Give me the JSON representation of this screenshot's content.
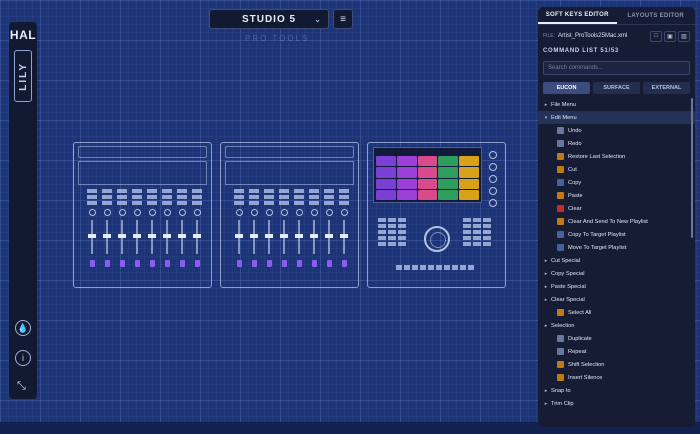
{
  "rail": {
    "logo_text": "HAL",
    "product_text": "LILY",
    "drop_icon": "drop-icon",
    "info_icon": "info-icon",
    "expand_icon": "expand-icon"
  },
  "header": {
    "studio_label": "STUDIO 5",
    "ghost_label": "PRO TOOLS"
  },
  "panel": {
    "tabs": [
      "SOFT KEYS EDITOR",
      "LAYOUTS EDITOR"
    ],
    "file_label": "FILE:",
    "file_name": "Artist_ProTools25Mac.xml",
    "command_list_title": "COMMAND LIST  51/53",
    "search_placeholder": "Search commands...",
    "segments": [
      "EUCON",
      "SURFACE",
      "EXTERNAL"
    ],
    "items": [
      {
        "kind": "folder",
        "open": false,
        "label": "File Menu"
      },
      {
        "kind": "folder",
        "open": true,
        "label": "Edit Menu"
      },
      {
        "kind": "cmd",
        "icon": "undo-icon",
        "color": "#6b7799",
        "label": "Undo"
      },
      {
        "kind": "cmd",
        "icon": "redo-icon",
        "color": "#6b7799",
        "label": "Redo"
      },
      {
        "kind": "cmd",
        "icon": "restore-icon",
        "color": "#c07a12",
        "label": "Restore Last Selection"
      },
      {
        "kind": "cmd",
        "icon": "cut-icon",
        "color": "#c07a12",
        "label": "Cut"
      },
      {
        "kind": "cmd",
        "icon": "copy-icon",
        "color": "#4a5f9c",
        "label": "Copy"
      },
      {
        "kind": "cmd",
        "icon": "paste-icon",
        "color": "#c07a12",
        "label": "Paste"
      },
      {
        "kind": "cmd",
        "icon": "clear-icon",
        "color": "#c42b2b",
        "label": "Clear"
      },
      {
        "kind": "cmd",
        "icon": "clear-send-icon",
        "color": "#c07a12",
        "label": "Clear And Send To New Playlist"
      },
      {
        "kind": "cmd",
        "icon": "copy-target-icon",
        "color": "#4a5f9c",
        "label": "Copy To Target Playlist"
      },
      {
        "kind": "cmd",
        "icon": "move-target-icon",
        "color": "#4a5f9c",
        "label": "Move To Target Playlist"
      },
      {
        "kind": "folder",
        "open": false,
        "label": "Cut Special"
      },
      {
        "kind": "folder",
        "open": false,
        "label": "Copy Special"
      },
      {
        "kind": "folder",
        "open": false,
        "label": "Paste Special"
      },
      {
        "kind": "folder",
        "open": false,
        "label": "Clear Special"
      },
      {
        "kind": "cmd",
        "icon": "select-all-icon",
        "color": "#c07a12",
        "label": "Select All"
      },
      {
        "kind": "folder",
        "open": false,
        "label": "Selection"
      },
      {
        "kind": "cmd",
        "icon": "duplicate-icon",
        "color": "#6b7799",
        "label": "Duplicate"
      },
      {
        "kind": "cmd",
        "icon": "repeat-icon",
        "color": "#6b7799",
        "label": "Repeat"
      },
      {
        "kind": "cmd",
        "icon": "shift-icon",
        "color": "#c07a12",
        "label": "Shift Selection"
      },
      {
        "kind": "cmd",
        "icon": "insert-silence-icon",
        "color": "#c07a12",
        "label": "Insert Silence"
      },
      {
        "kind": "folder",
        "open": false,
        "label": "Snap to"
      },
      {
        "kind": "folder",
        "open": false,
        "label": "Trim Clip"
      }
    ]
  },
  "colors": {
    "background": "#1d3577",
    "panel": "#151c33",
    "accent": "#8a5cf0",
    "touch_keys": [
      "#7c3fd6",
      "#9b3fd6",
      "#d84a8a",
      "#2f9d5b",
      "#d7a21a",
      "#2a7fd4"
    ]
  }
}
